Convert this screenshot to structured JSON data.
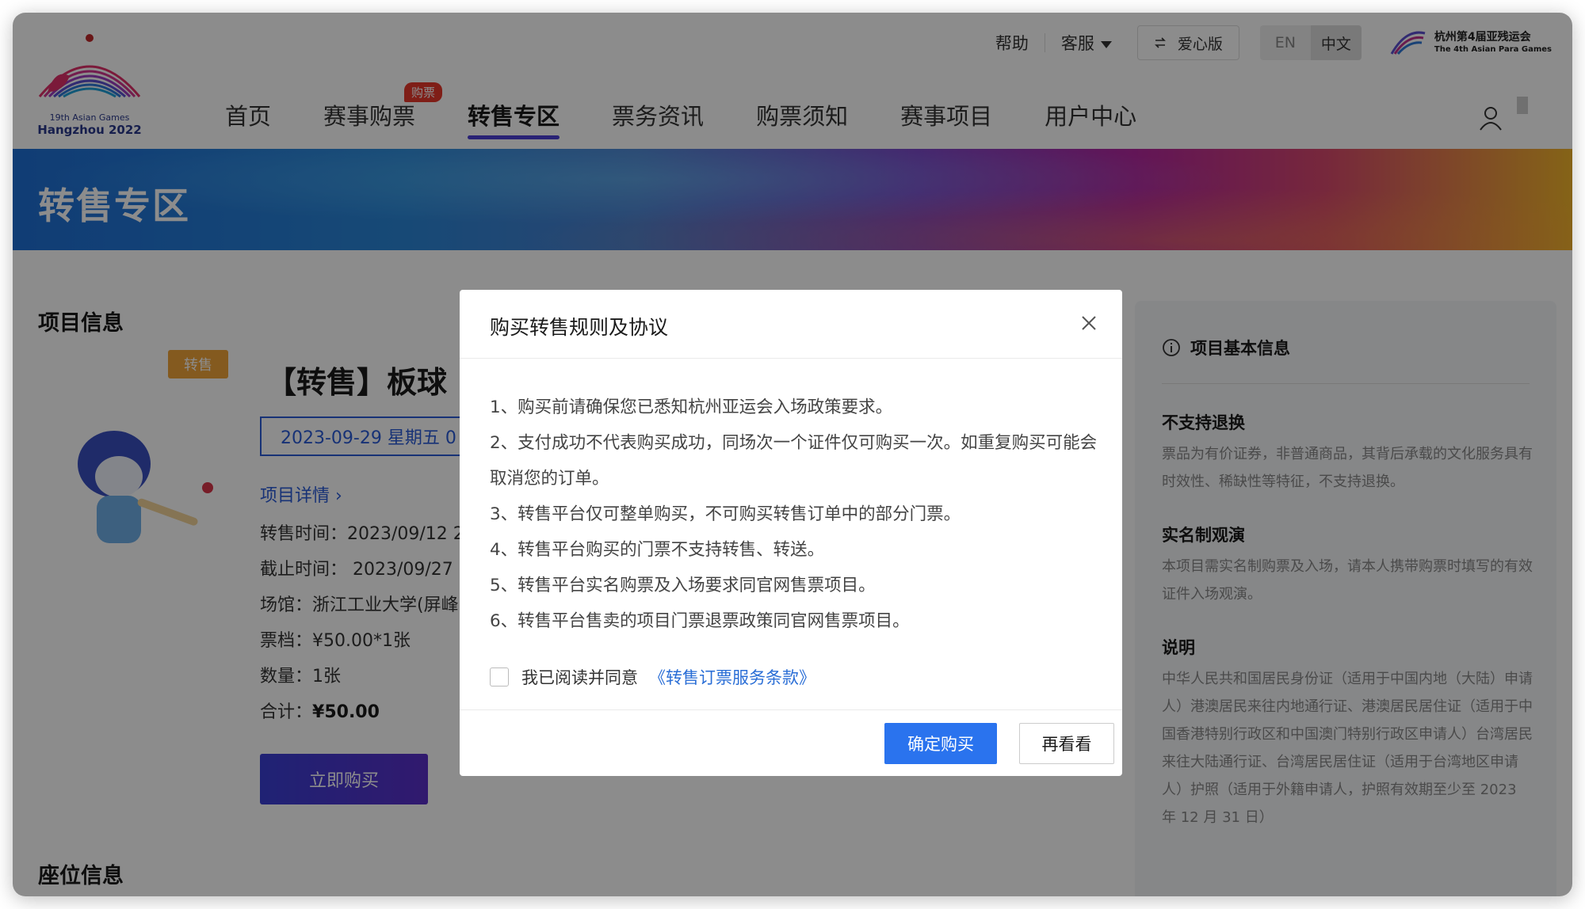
{
  "header": {
    "logo": {
      "line1": "19th Asian Games",
      "line2": "Hangzhou 2022"
    },
    "topbar": {
      "help": "帮助",
      "service": "客服",
      "care_version": "爱心版",
      "care_icon": "swap-arrows-icon",
      "lang_en": "EN",
      "lang_zh": "中文",
      "para_title": "杭州第4届亚残运会",
      "para_subtitle": "The 4th Asian Para Games"
    },
    "nav": [
      {
        "label": "首页"
      },
      {
        "label": "赛事购票",
        "badge": "购票"
      },
      {
        "label": "转售专区",
        "active": true
      },
      {
        "label": "票务资讯"
      },
      {
        "label": "购票须知"
      },
      {
        "label": "赛事项目"
      },
      {
        "label": "用户中心"
      }
    ]
  },
  "banner": {
    "title": "转售专区"
  },
  "project": {
    "section_title": "项目信息",
    "tag": "转售",
    "title": "【转售】板球",
    "date": "2023-09-29 星期五 0",
    "detail_link": "项目详情",
    "sale_time": "转售时间：2023/09/12 2",
    "deadline": "截止时间：  2023/09/27",
    "venue": "场馆：浙江工业大学(屏峰",
    "tier": "票档：¥50.00*1张",
    "quantity": "数量：1张",
    "total_label": "合计：",
    "total_value": "¥50.00",
    "buy_button": "立即购买"
  },
  "seat": {
    "section_title": "座位信息"
  },
  "side_panel": {
    "head": "项目基本信息",
    "blocks": [
      {
        "title": "不支持退换",
        "text": "票品为有价证券，非普通商品，其背后承载的文化服务具有时效性、稀缺性等特征，不支持退换。"
      },
      {
        "title": "实名制观演",
        "text": "本项目需实名制购票及入场，请本人携带购票时填写的有效证件入场观演。"
      },
      {
        "title": "说明",
        "text": "中华人民共和国居民身份证（适用于中国内地（大陆）申请人）港澳居民来往内地通行证、港澳居民居住证（适用于中国香港特别行政区和中国澳门特别行政区申请人）台湾居民来往大陆通行证、台湾居民居住证（适用于台湾地区申请人）护照（适用于外籍申请人，护照有效期至少至 2023 年 12 月 31 日）"
      }
    ]
  },
  "modal": {
    "title": "购买转售规则及协议",
    "rules": [
      "1、购买前请确保您已悉知杭州亚运会入场政策要求。",
      "2、支付成功不代表购买成功，同场次一个证件仅可购买一次。如重复购买可能会取消您的订单。",
      "3、转售平台仅可整单购买，不可购买转售订单中的部分门票。",
      "4、转售平台购买的门票不支持转售、转送。",
      "5、转售平台实名购票及入场要求同官网售票项目。",
      "6、转售平台售卖的项目门票退票政策同官网售票项目。"
    ],
    "agree_text": "我已阅读并同意",
    "agree_link": "《转售订票服务条款》",
    "confirm_button": "确定购买",
    "cancel_button": "再看看"
  },
  "colors": {
    "primary": "#2a73ee",
    "nav_active": "#4b3fd6",
    "badge": "#e8372b",
    "tag": "#f0a53a",
    "link": "#2a6ed6"
  }
}
